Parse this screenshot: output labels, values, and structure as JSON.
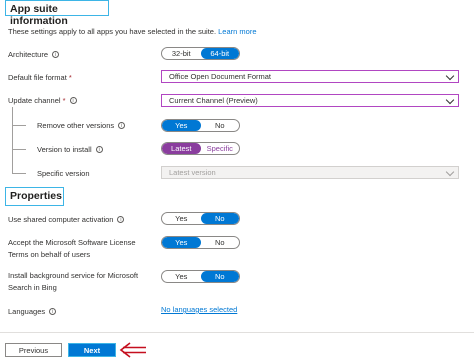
{
  "app_suite": {
    "title": "App suite information",
    "description": "These settings apply to all apps you have selected in the suite.",
    "learn_more": "Learn more",
    "architecture": {
      "label": "Architecture",
      "options": [
        "32-bit",
        "64-bit"
      ],
      "selected": "64-bit"
    },
    "file_format": {
      "label": "Default file format",
      "required": "*",
      "value": "Office Open Document Format"
    },
    "update_channel": {
      "label": "Update channel",
      "required": "*",
      "value": "Current Channel (Preview)"
    },
    "remove_other": {
      "label": "Remove other versions",
      "options": [
        "Yes",
        "No"
      ],
      "selected": "Yes"
    },
    "version_to_install": {
      "label": "Version to install",
      "options": [
        "Latest",
        "Specific"
      ],
      "selected": "Latest"
    },
    "specific_version": {
      "label": "Specific version",
      "placeholder": "Latest version"
    }
  },
  "properties": {
    "title": "Properties",
    "shared_activation": {
      "label": "Use shared computer activation",
      "options": [
        "Yes",
        "No"
      ],
      "selected": "No"
    },
    "accept_license": {
      "label_line1": "Accept the Microsoft Software License",
      "label_line2": "Terms on behalf of users",
      "options": [
        "Yes",
        "No"
      ],
      "selected": "Yes"
    },
    "background_service": {
      "label_line1": "Install background service for Microsoft",
      "label_line2": "Search in Bing",
      "options": [
        "Yes",
        "No"
      ],
      "selected": "No"
    },
    "languages": {
      "label": "Languages",
      "value": "No languages selected"
    }
  },
  "footer": {
    "previous": "Previous",
    "next": "Next"
  },
  "colors": {
    "accent": "#0078d4",
    "purple_accent": "#8a3d9e",
    "highlight_border": "#3db5e6",
    "arrow": "#c50f1f"
  }
}
